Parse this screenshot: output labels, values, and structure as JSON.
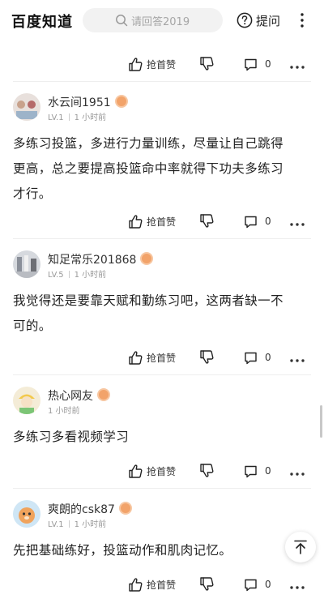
{
  "header": {
    "logo": "百度知道",
    "search_placeholder": "请回答2019",
    "ask_label": "提问",
    "icons": [
      "search-icon",
      "question-circle-icon",
      "more-vertical-icon"
    ]
  },
  "actions": {
    "like_label": "抢首赞",
    "comment_count": "0",
    "icons": [
      "thumb-up-icon",
      "thumb-down-icon",
      "comment-icon",
      "more-horizontal-icon"
    ]
  },
  "answers": [
    {
      "username": "水云间1951",
      "level": "LV.1",
      "time": "1 小时前",
      "lines": [
        "多练习投篮，多进行力量训练，尽量让自己跳得",
        "更高，总之要提高投篮命中率就得下功夫多练习",
        "才行。"
      ]
    },
    {
      "username": "知足常乐201868",
      "level": "LV.5",
      "time": "1 小时前",
      "lines": [
        "我觉得还是要靠天赋和勤练习吧，这两者缺一不",
        "可的。"
      ]
    },
    {
      "username": "热心网友",
      "level": "",
      "time": "1 小时前",
      "lines": [
        "多练习多看视频学习"
      ]
    },
    {
      "username": "爽朗的csk87",
      "level": "LV.1",
      "time": "1 小时前",
      "lines": [
        "先把基础练好，投篮动作和肌肉记忆。"
      ]
    }
  ],
  "colors": {
    "badge": "#f2a36a",
    "divider": "#eeeeee"
  }
}
